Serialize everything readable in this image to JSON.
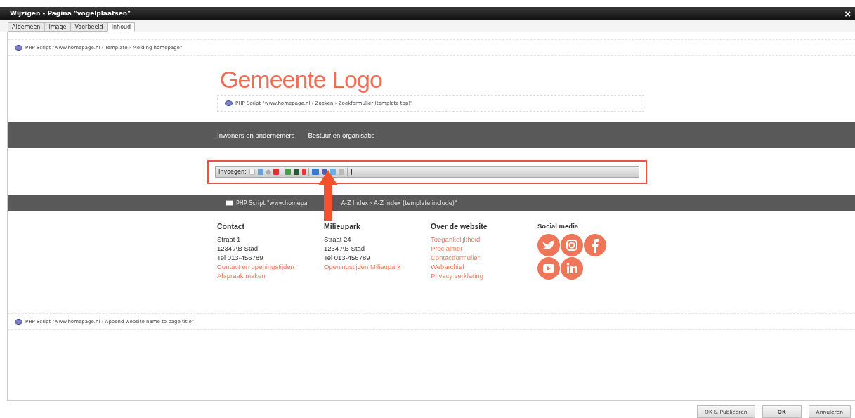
{
  "window": {
    "title": "Wijzigen - Pagina \"vogelplaatsen\"",
    "close": "×"
  },
  "tabs": [
    {
      "label": "Algemeen",
      "selected": false
    },
    {
      "label": "Image",
      "selected": false
    },
    {
      "label": "Voorbeeld",
      "selected": false
    },
    {
      "label": "Inhoud",
      "selected": true
    }
  ],
  "script_top": "PHP Script \"www.homepage.nl › Template › Melding homepage\"",
  "logo": "Gemeente Logo",
  "search_script": "PHP Script \"www.homepage.nl ›  Zoeken › Zoekformulier (template top)\"",
  "nav": [
    "Inwoners en ondernemers",
    "Bestuur en organisatie"
  ],
  "toolbar": {
    "label": "Invoegen:"
  },
  "index_script": {
    "visible_start": "PHP Script \"www.homepa",
    "visible_end": "A-Z Index › A-Z Index (template include)\""
  },
  "footer": [
    {
      "heading": "Contact",
      "lines": [
        "Straat 1",
        "1234 AB  Stad",
        "Tel 013-456789"
      ],
      "links": [
        "Contact en openingstijden",
        "Afspraak maken"
      ]
    },
    {
      "heading": "Milieupark",
      "lines": [
        "Straat 24",
        "1234 AB  Stad",
        "Tel 013-456789"
      ],
      "links": [
        "Openingstijden Milieupark"
      ]
    },
    {
      "heading": "Over de website",
      "links": [
        "Toegankelijkheid",
        "Proclaimer",
        "Contactformulier",
        "Webarchief",
        "Privacy verklaring"
      ]
    }
  ],
  "social": {
    "heading": "Social media"
  },
  "script_bottom": "PHP Script \"www.homepage.nl › Append website name to page title\"",
  "buttons": [
    "OK & Publiceren",
    "OK",
    "Annuleren"
  ]
}
